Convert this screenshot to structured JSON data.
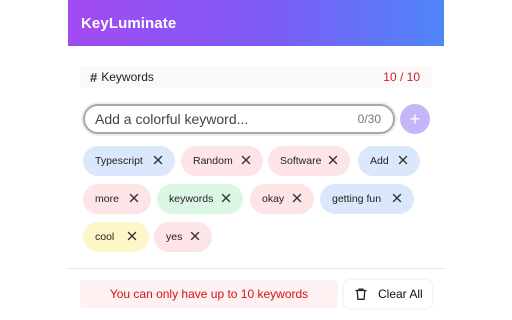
{
  "app": {
    "title": "KeyLuminate"
  },
  "keywords_section": {
    "icon": "hash-icon",
    "label": "Keywords",
    "count": "10 / 10"
  },
  "input": {
    "placeholder": "Add a colorful keyword...",
    "value": "",
    "char_count": "0/30"
  },
  "add_button": {
    "icon": "plus-icon",
    "label": "+"
  },
  "tags": [
    {
      "text": "Typescript",
      "bg": "#dbe7fb"
    },
    {
      "text": "Random",
      "bg": "#fde4e6"
    },
    {
      "text": "Software",
      "bg": "#fde4e6"
    },
    {
      "text": "Add",
      "bg": "#dbe7fb"
    },
    {
      "text": "more",
      "bg": "#fde4e6"
    },
    {
      "text": "keywords",
      "bg": "#dcf6e6"
    },
    {
      "text": "okay",
      "bg": "#fde4e6"
    },
    {
      "text": "getting fun",
      "bg": "#dbe7fb"
    },
    {
      "text": "cool",
      "bg": "#fdf6c9"
    },
    {
      "text": "yes",
      "bg": "#fde4e6"
    }
  ],
  "footer": {
    "notice": "You can only have up to 10 keywords",
    "clear_icon": "trash-icon",
    "clear_label": "Clear All"
  },
  "colors": {
    "header_start": "#a24bf1",
    "header_end": "#4f86f8",
    "count_red": "#d0201a",
    "notice_text": "#d4131a",
    "add_button": "#c6b5f8"
  }
}
